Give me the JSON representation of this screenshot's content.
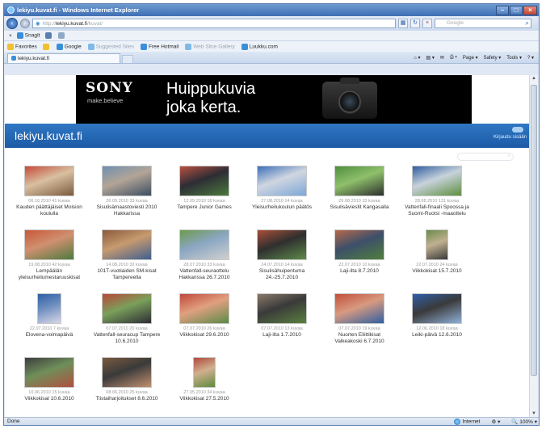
{
  "window": {
    "title": "lekiyu.kuvat.fi - Windows Internet Explorer"
  },
  "address": {
    "url_prefix": "http://",
    "url_host": "lekiyu.kuvat.fi",
    "url_suffix": "/kuvat/",
    "search_placeholder": "Google"
  },
  "toolbar": {
    "close": "×",
    "snagit": "SnagIt"
  },
  "favorites": {
    "label": "Favorites",
    "items": [
      {
        "label": "Google",
        "muted": false,
        "color": "#3a8fd8"
      },
      {
        "label": "Suggested Sites",
        "muted": true,
        "color": "#7fb9e6"
      },
      {
        "label": "Free Hotmail",
        "muted": false,
        "color": "#3a8fd8"
      },
      {
        "label": "Web Slice Gallery",
        "muted": true,
        "color": "#7fb9e6"
      },
      {
        "label": "Luukku.com",
        "muted": false,
        "color": "#3a8fd8"
      }
    ]
  },
  "tab": {
    "label": "lekiyu.kuvat.fi"
  },
  "commandbar": {
    "page": "Page ▾",
    "safety": "Safety ▾",
    "tools": "Tools ▾"
  },
  "banner": {
    "brand": "SONY",
    "tagline": "make.believe",
    "line1": "Huippukuvia",
    "line2": "joka kerta."
  },
  "site": {
    "title": "lekiyu.kuvat.fi",
    "login": "Kirjaudu sisään"
  },
  "albums": [
    {
      "meta": "06.10.2010   41 kuvaa",
      "name": "Kauden päättäjäiset Moision koululla",
      "colors": [
        "#c54a3a",
        "#7b5b3e",
        "#d8c0a0"
      ],
      "w": 62
    },
    {
      "meta": "26.09.2010   33 kuvaa",
      "name": "Sisulisämaastoviesti 2010 Hakkarissa",
      "colors": [
        "#6f8fb0",
        "#3c4e63",
        "#b3a596"
      ],
      "w": 62
    },
    {
      "meta": "12.09.2010   18 kuvaa",
      "name": "Tampere Junior Games",
      "colors": [
        "#b85040",
        "#4b7a3d",
        "#2d2d35"
      ],
      "w": 62
    },
    {
      "meta": "27.08.2010   14 kuvaa",
      "name": "Yleisurheilukoulun päätös",
      "colors": [
        "#3b6fb8",
        "#7da7d8",
        "#d0d6e0"
      ],
      "w": 62
    },
    {
      "meta": "26.08.2010   15 kuvaa",
      "name": "Sisulisäviestit Kangasalla",
      "colors": [
        "#4f8e3d",
        "#2d2d2d",
        "#8fc06b"
      ],
      "w": 62
    },
    {
      "meta": "28.08.2010   131 kuvaa",
      "name": "Vattenfall-finaali Spoossa ja Suomi-Ruotsi -maaottelu",
      "colors": [
        "#2f5e9e",
        "#5f8f3e",
        "#c8d2dc"
      ],
      "w": 62
    },
    {
      "meta": "19.08.2010   42 kuvaa",
      "name": "Lempäälän yleisurheilumestaruuskisat",
      "colors": [
        "#c85838",
        "#4d7a3e",
        "#d09070"
      ],
      "w": 62
    },
    {
      "meta": "14.08.2010   32 kuvaa",
      "name": "101T-vuotiaiden SM-kisat Tampereella",
      "colors": [
        "#8a5a3a",
        "#3e5f8e",
        "#c79a6f"
      ],
      "w": 62
    },
    {
      "meta": "28.07.2010   33 kuvaa",
      "name": "Vattenfall-seuraottelu Hakkarissa 26.7.2010",
      "colors": [
        "#6c9a4c",
        "#d0d0d0",
        "#8aa6c2"
      ],
      "w": 62
    },
    {
      "meta": "24.07.2010   14 kuvaa",
      "name": "Sisulisähuipentuma 24.-25.7.2010",
      "colors": [
        "#a84f38",
        "#5d8a4a",
        "#2f2f2f"
      ],
      "w": 62
    },
    {
      "meta": "22.07.2010   10 kuvaa",
      "name": "Laji-ilta 8.7.2010",
      "colors": [
        "#b66a4a",
        "#4f7f3d",
        "#3d4f6a"
      ],
      "w": 62
    },
    {
      "meta": "22.07.2010   24 kuvaa",
      "name": "Viikkokisat 15.7.2010",
      "colors": [
        "#6a8a4a",
        "#3a3a3a",
        "#c0b090"
      ],
      "w": 28
    },
    {
      "meta": "22.07.2010   7 kuvaa",
      "name": "Elovena-voimapäivä",
      "colors": [
        "#2f5fa8",
        "#d8d8e8",
        "#6f8fbf"
      ],
      "w": 30
    },
    {
      "meta": "07.07.2010   20 kuvaa",
      "name": "Vattenfall-seuracup Tampere 10.6.2010",
      "colors": [
        "#b8483a",
        "#2d2d35",
        "#7aa05a"
      ],
      "w": 62
    },
    {
      "meta": "07.07.2010   26 kuvaa",
      "name": "Viikkokisat 29.6.2010",
      "colors": [
        "#c0483c",
        "#5a8a48",
        "#e0a080"
      ],
      "w": 62
    },
    {
      "meta": "07.07.2010   13 kuvaa",
      "name": "Laji-ilta 1.7.2010",
      "colors": [
        "#8a7a6a",
        "#5a8040",
        "#3a3a3a"
      ],
      "w": 62
    },
    {
      "meta": "07.07.2010   19 kuvaa",
      "name": "Nuorten Eliittikisat Valkeakoski 6.7.2010",
      "colors": [
        "#c24e3a",
        "#2f5fa0",
        "#d89a80"
      ],
      "w": 62
    },
    {
      "meta": "12.06.2010   18 kuvaa",
      "name": "Leiki-päivä 12.6.2010",
      "colors": [
        "#2f5fa8",
        "#8fb0d8",
        "#3a3a3a"
      ],
      "w": 62
    },
    {
      "meta": "10.06.2010   15 kuvaa",
      "name": "Viikkokisat 10.6.2010",
      "colors": [
        "#3d3d3d",
        "#b05040",
        "#6f8f5a"
      ],
      "w": 62
    },
    {
      "meta": "08.06.2010   25 kuvaa",
      "name": "Tiistaiharjoitukset 8.6.2010",
      "colors": [
        "#7a5a3e",
        "#c09070",
        "#3a3a3a"
      ],
      "w": 62
    },
    {
      "meta": "27.05.2010   34 kuvaa",
      "name": "Viikkokisat 27.5.2010",
      "colors": [
        "#b04a3a",
        "#5f8a3e",
        "#d0b090"
      ],
      "w": 28
    }
  ],
  "status": {
    "text": "Done",
    "zone": "Internet",
    "zoom": "100%"
  }
}
